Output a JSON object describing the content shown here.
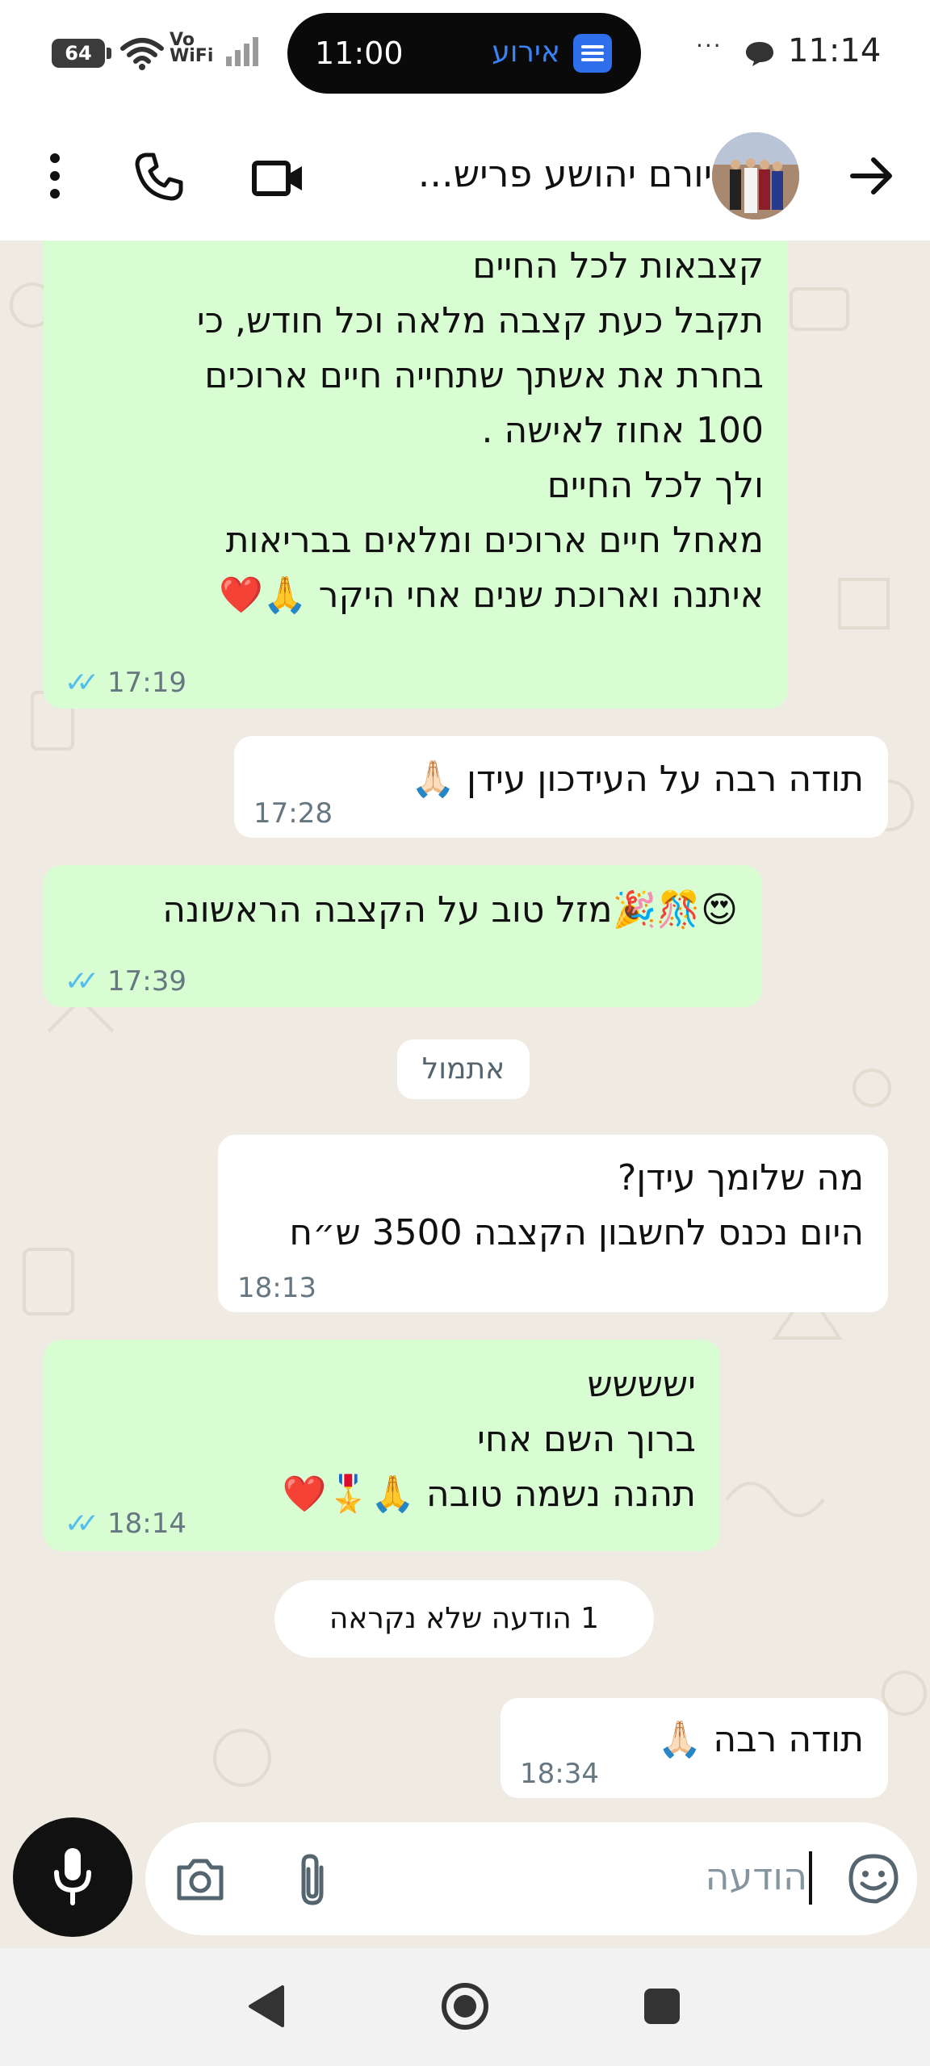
{
  "status_bar": {
    "battery": "64",
    "network": "Vo\nWiFi",
    "island_time": "11:00",
    "island_label": "אירוע",
    "more": "···",
    "time": "11:14"
  },
  "header": {
    "contact_name": "יורם יהושע פריש..."
  },
  "messages": [
    {
      "type": "out",
      "text": "קצבאות לכל החיים\nתקבל כעת קצבה מלאה וכל חודש, כי\nבחרת את  אשתך שתחייה חיים ארוכים\n100 אחוז לאישה .\nולך לכל החיים\nמאחל חיים ארוכים ומלאים בבריאות\nאיתנה וארוכת שנים אחי היקר 🙏❤️",
      "time": "17:19"
    },
    {
      "type": "in",
      "text": "תודה רבה על העידכון עידן 🙏🏻",
      "time": "17:28"
    },
    {
      "type": "out",
      "text": "😍🎊🎉מזל טוב על הקצבה הראשונה",
      "time": "17:39"
    },
    {
      "type": "in",
      "text": "מה שלומך עידן?\nהיום נכנס לחשבון הקצבה 3500 ש״ח",
      "time": "18:13"
    },
    {
      "type": "out",
      "text": "ישששש\nברוך השם אחי\nתהנה נשמה טובה 🙏🎖️❤️",
      "time": "18:14"
    },
    {
      "type": "in",
      "text": "תודה רבה 🙏🏻",
      "time": "18:34"
    }
  ],
  "date_divider": "אתמול",
  "unread_divider": "1 הודעה שלא נקראה",
  "composer": {
    "placeholder": "הודעה"
  },
  "icons": {
    "back": "arrow-left-icon",
    "call": "phone-icon",
    "video": "video-camera-icon",
    "menu": "kebab-menu-icon",
    "emoji": "sticker-icon",
    "attach": "paperclip-icon",
    "camera": "camera-icon",
    "mic": "microphone-icon"
  },
  "colors": {
    "outgoing_bubble": "#d9fdd3",
    "incoming_bubble": "#ffffff",
    "chat_background": "#efeae2",
    "read_ticks": "#53bdeb"
  }
}
